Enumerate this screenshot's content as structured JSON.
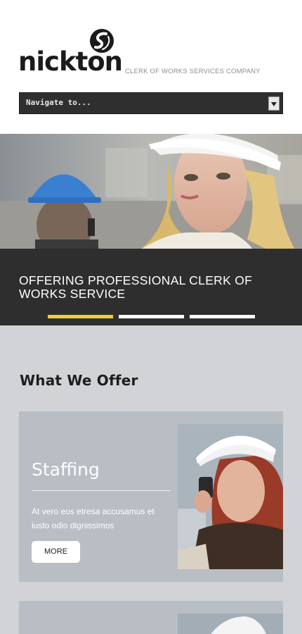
{
  "brand": {
    "name": "nickton",
    "tagline": "CLERK OF WORKS SERVICES COMPANY"
  },
  "nav": {
    "selected": "Navigate to..."
  },
  "hero": {
    "caption": "OFFERING PROFESSIONAL CLERK OF WORKS SERVICE",
    "slides": 3,
    "active_slide": 1,
    "colors": {
      "active_dot": "#f0cc3a",
      "caption_bg": "#2e2e2e"
    }
  },
  "offer": {
    "title": "What We Offer",
    "cards": [
      {
        "title": "Staffing",
        "text": "At vero eos etresa accusamus et iusto odio dignissimos",
        "button": "MORE"
      }
    ]
  }
}
